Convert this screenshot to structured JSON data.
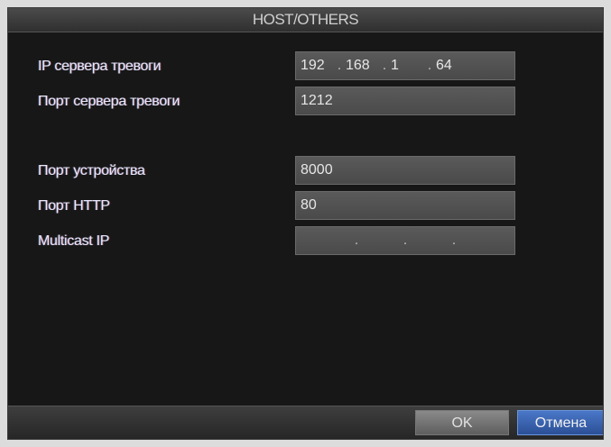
{
  "dialog": {
    "title": "HOST/OTHERS"
  },
  "fields": {
    "alarm_server_ip": {
      "label": "IP сервера тревоги",
      "segments": [
        "192",
        "168",
        "1",
        "64"
      ]
    },
    "alarm_server_port": {
      "label": "Порт сервера тревоги",
      "value": "1212"
    },
    "device_port": {
      "label": "Порт устройства",
      "value": "8000"
    },
    "http_port": {
      "label": "Порт HTTP",
      "value": "80"
    },
    "multicast_ip": {
      "label": "Multicast IP",
      "segments": [
        "",
        "",
        "",
        ""
      ]
    }
  },
  "buttons": {
    "ok_label": "OK",
    "cancel_label": "Отмена"
  },
  "colors": {
    "background": "#171717",
    "field": "#4f4f4f",
    "cancel_button": "#3561b0"
  }
}
